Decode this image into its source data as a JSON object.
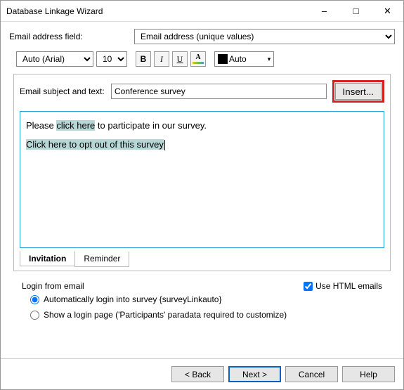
{
  "window": {
    "title": "Database Linkage Wizard"
  },
  "emailField": {
    "label": "Email address field:",
    "value": "Email address (unique values)"
  },
  "format": {
    "font": "Auto (Arial)",
    "size": "10",
    "b": "B",
    "i": "I",
    "u": "U",
    "colorLabel": "Auto"
  },
  "subject": {
    "label": "Email subject and text:",
    "value": "Conference survey",
    "insert": "Insert..."
  },
  "editor": {
    "line1_pre": "Please ",
    "line1_link": "click here",
    "line1_post": " to participate in our survey.",
    "line2": "Click here to opt out of this survey"
  },
  "tabs": {
    "invitation": "Invitation",
    "reminder": "Reminder"
  },
  "login": {
    "header": "Login from email",
    "radio1": "Automatically login into survey {surveyLinkauto}",
    "radio2": "Show a login page ('Participants' paradata required to customize)",
    "useHtml": "Use HTML emails"
  },
  "footer": {
    "back": "< Back",
    "next": "Next >",
    "cancel": "Cancel",
    "help": "Help"
  }
}
